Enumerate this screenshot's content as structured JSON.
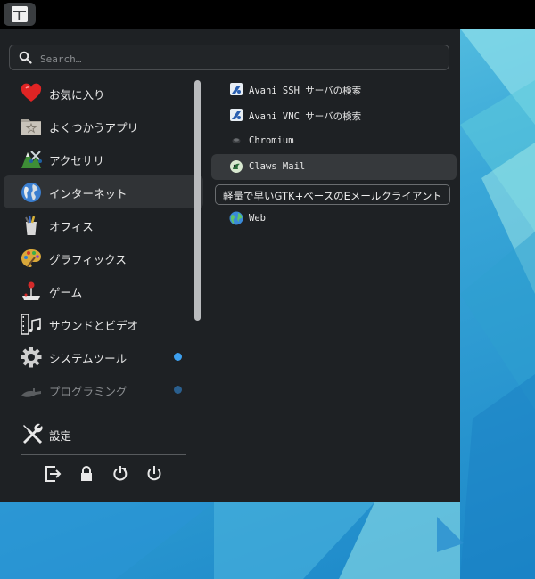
{
  "search": {
    "placeholder": "Search…"
  },
  "categories": [
    {
      "label": "お気に入り",
      "icon": "heart-icon",
      "badge": false
    },
    {
      "label": "よくつかうアプリ",
      "icon": "recent-folder-icon",
      "badge": false
    },
    {
      "label": "アクセサリ",
      "icon": "accessories-icon",
      "badge": false
    },
    {
      "label": "インターネット",
      "icon": "globe-icon",
      "badge": false,
      "selected": true
    },
    {
      "label": "オフィス",
      "icon": "office-icon",
      "badge": false
    },
    {
      "label": "グラフィックス",
      "icon": "palette-icon",
      "badge": false
    },
    {
      "label": "ゲーム",
      "icon": "joystick-icon",
      "badge": false
    },
    {
      "label": "サウンドとビデオ",
      "icon": "film-music-icon",
      "badge": false
    },
    {
      "label": "システムツール",
      "icon": "gear-icon",
      "badge": true
    },
    {
      "label": "プログラミング",
      "icon": "trowel-icon",
      "badge": true,
      "disabled": true
    }
  ],
  "settings": {
    "label": "設定"
  },
  "apps": [
    {
      "label": "Avahi SSH サーバの検索",
      "icon": "avahi-icon"
    },
    {
      "label": "Avahi VNC サーバの検索",
      "icon": "avahi-icon"
    },
    {
      "label": "Chromium",
      "icon": "chromium-icon"
    },
    {
      "label": "Claws Mail",
      "icon": "claws-mail-icon",
      "hover": true
    },
    {
      "label": "",
      "icon": ""
    },
    {
      "label": "Web",
      "icon": "web-globe-icon"
    }
  ],
  "tooltip": {
    "text": "軽量で早いGTK+ベースのEメールクライアント"
  },
  "actions": [
    "logout-icon",
    "lock-icon",
    "restart-icon",
    "power-icon"
  ],
  "colors": {
    "accent": "#3da0ef",
    "menu_bg": "#1e2124",
    "panel_bg": "#000000"
  }
}
